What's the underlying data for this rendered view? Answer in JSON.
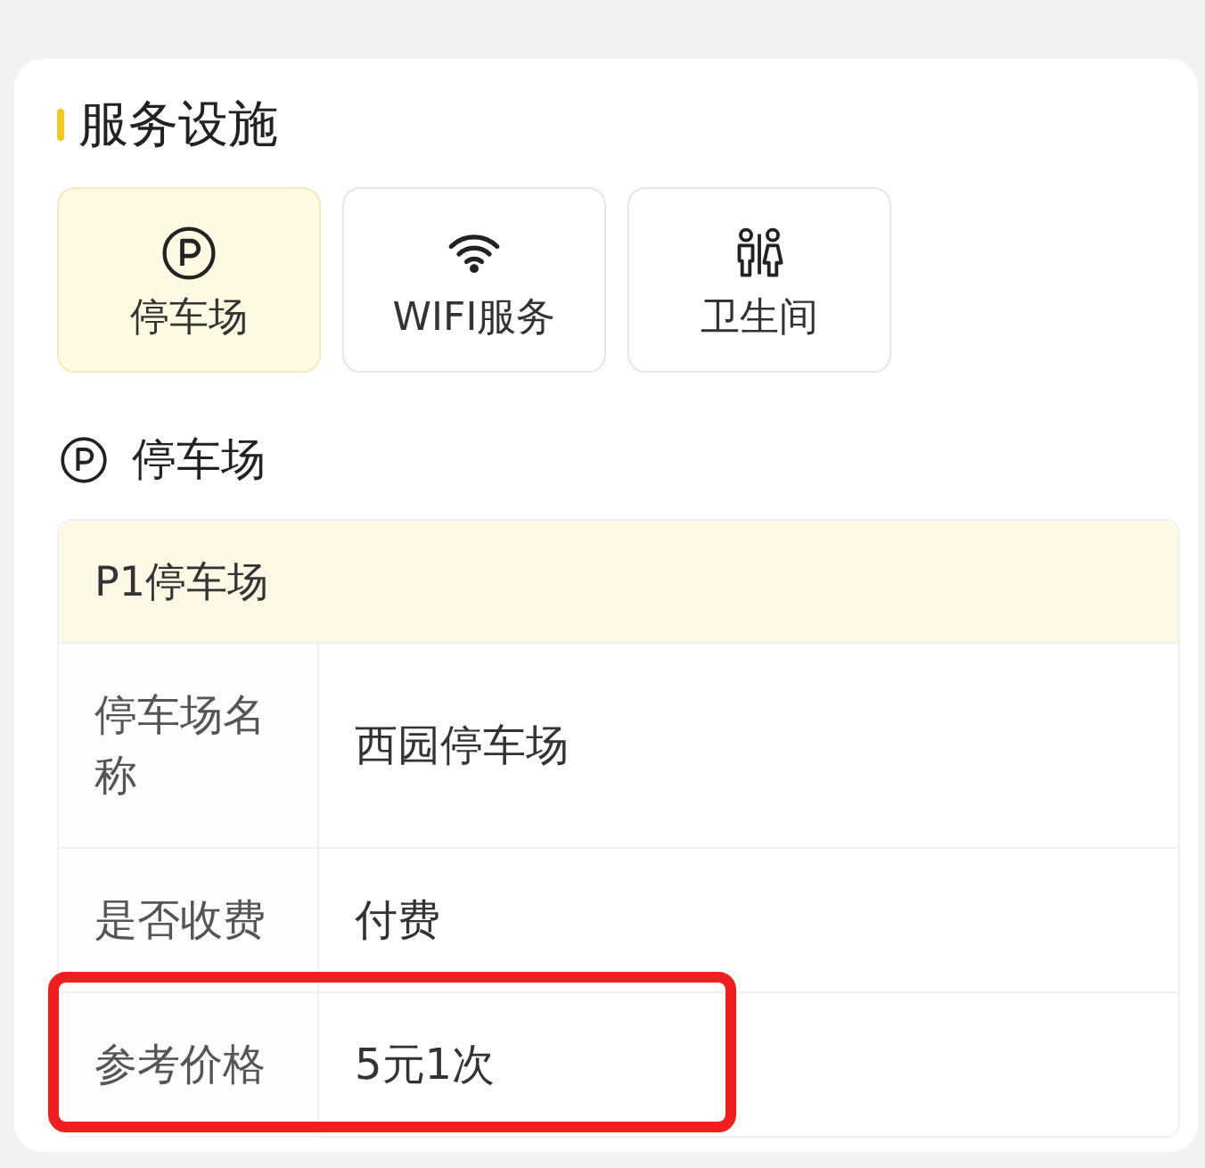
{
  "card": {
    "title": "服务设施",
    "tabs": [
      {
        "label": "停车场",
        "kind": "parking",
        "selected": true
      },
      {
        "label": "WIFI服务",
        "kind": "wifi",
        "selected": false
      },
      {
        "label": "卫生间",
        "kind": "restroom",
        "selected": false
      }
    ],
    "section": {
      "title": "停车场",
      "kind": "parking"
    },
    "table": {
      "header": "P1停车场",
      "rows": [
        {
          "label": "停车场名称",
          "value": "西园停车场",
          "highlighted": false
        },
        {
          "label": "是否收费",
          "value": "付费",
          "highlighted": false
        },
        {
          "label": "参考价格",
          "value": "5元1次",
          "highlighted": true
        }
      ]
    }
  }
}
